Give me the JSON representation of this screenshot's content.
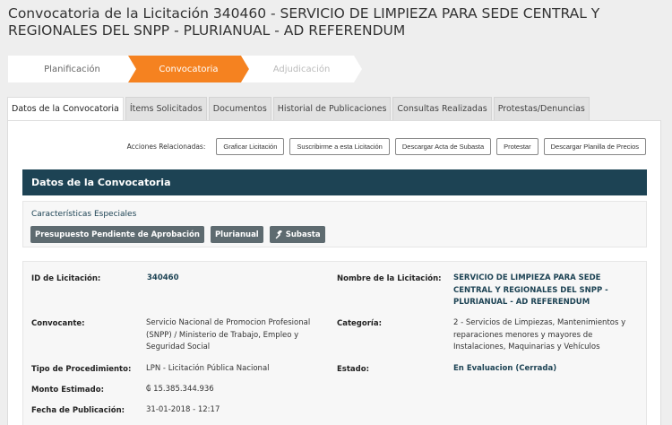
{
  "page": {
    "title": "Convocatoria de la Licitación 340460 - SERVICIO DE LIMPIEZA PARA SEDE CENTRAL Y REGIONALES DEL SNPP - PLURIANUAL - AD REFERENDUM"
  },
  "steps": [
    {
      "label": "Planificación",
      "state": "done"
    },
    {
      "label": "Convocatoria",
      "state": "active"
    },
    {
      "label": "Adjudicación",
      "state": "pending"
    }
  ],
  "tabs": [
    {
      "label": "Datos de la Convocatoria",
      "active": true
    },
    {
      "label": "Ítems Solicitados",
      "active": false
    },
    {
      "label": "Documentos",
      "active": false
    },
    {
      "label": "Historial de Publicaciones",
      "active": false
    },
    {
      "label": "Consultas Realizadas",
      "active": false
    },
    {
      "label": "Protestas/Denuncias",
      "active": false
    }
  ],
  "actions": {
    "label": "Acciones Relacionadas:",
    "buttons": [
      "Graficar Licitación",
      "Suscribirme a esta Licitación",
      "Descargar Acta de Subasta",
      "Protestar",
      "Descargar Planilla de Precios"
    ]
  },
  "section": {
    "title": "Datos de la Convocatoria"
  },
  "features": {
    "title": "Características Especiales",
    "badges": [
      "Presupuesto Pendiente de Aprobación",
      "Plurianual",
      "Subasta"
    ]
  },
  "details": {
    "id_label": "ID de Licitación:",
    "id_value": "340460",
    "nombre_label": "Nombre de la Licitación:",
    "nombre_value": "SERVICIO DE LIMPIEZA PARA SEDE CENTRAL Y REGIONALES DEL SNPP - PLURIANUAL - AD REFERENDUM",
    "convocante_label": "Convocante:",
    "convocante_value": "Servicio Nacional de Promocion Profesional (SNPP) / Ministerio de Trabajo, Empleo y Seguridad Social",
    "categoria_label": "Categoría:",
    "categoria_value": "2 - Servicios de Limpiezas, Mantenimientos y reparaciones menores y mayores de Instalaciones, Maquinarias y Vehículos",
    "tipo_label": "Tipo de Procedimiento:",
    "tipo_value": "LPN - Licitación Pública Nacional",
    "estado_label": "Estado:",
    "estado_value": "En Evaluacion (Cerrada)",
    "monto_label": "Monto Estimado:",
    "monto_value": "₲ 15.385.344.936",
    "fecha_label": "Fecha de Publicación:",
    "fecha_value": "31-01-2018 - 12:17"
  },
  "colors": {
    "accent": "#f58220",
    "header": "#1d4354",
    "badge": "#5e6b70"
  }
}
